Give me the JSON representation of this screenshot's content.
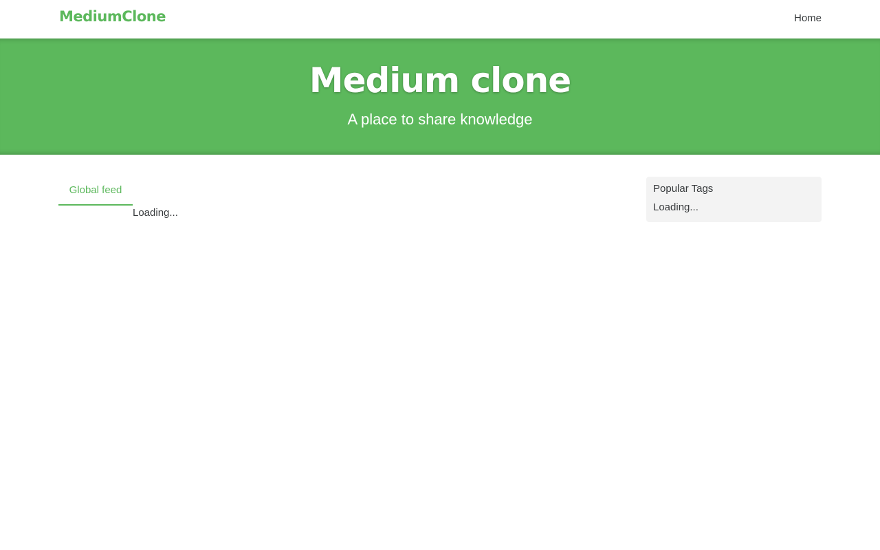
{
  "navbar": {
    "brand": "MediumClone",
    "links": [
      {
        "label": "Home"
      }
    ]
  },
  "banner": {
    "title": "Medium clone",
    "subtitle": "A place to share knowledge"
  },
  "feed": {
    "tabs": [
      {
        "label": "Global feed",
        "active": true
      }
    ],
    "status": "Loading..."
  },
  "sidebar": {
    "title": "Popular Tags",
    "status": "Loading..."
  },
  "colors": {
    "accent": "#5cb85c",
    "text": "#373a3c",
    "sidebar_bg": "#f3f3f3",
    "background": "#ffffff"
  }
}
